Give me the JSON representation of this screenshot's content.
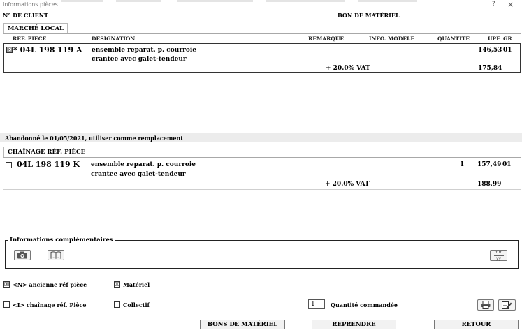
{
  "window": {
    "title": "Informations pièces",
    "help": "?",
    "close": "×"
  },
  "header": {
    "client_label": "N° DE CLIENT",
    "doc_label": "BON DE MATÉRIEL"
  },
  "tab_market": "MARCHÉ LOCAL",
  "columns": {
    "ref": "RÉF. PIÈCE",
    "designation": "DÉSIGNATION",
    "remarque": "REMARQUE",
    "info_modele": "INFO. MODÈLE",
    "quantite": "QUANTITÉ",
    "upe": "UPE",
    "gr": "GR"
  },
  "part_main": {
    "checked": "☒",
    "ref": "* 04L 198 119 A",
    "designation_1": "ensemble reparat. p. courroie",
    "designation_2": "crantee avec galet-tendeur",
    "quantity": "",
    "upe": "146,53",
    "gr": "01",
    "vat_label": "+ 20.0% VAT",
    "vat_price": "175,84"
  },
  "notice": "Abandonné le 01/05/2021, utiliser comme remplacement",
  "tab_chain": "CHAÎNAGE RÉF. PIÈCE",
  "part_replacement": {
    "ref": "04L 198 119 K",
    "designation_1": "ensemble reparat. p. courroie",
    "designation_2": "crantee avec galet-tendeur",
    "quantity": "1",
    "upe": "157,49",
    "gr": "01",
    "vat_label": "+ 20.0% VAT",
    "vat_price": "188,99"
  },
  "info_group": {
    "legend": "Informations complémentaires",
    "date_top": "mm",
    "date_bottom": "yy"
  },
  "options": {
    "old_ref_mark": "☒",
    "old_ref_label": "<N> ancienne réf pièce",
    "materiel_mark": "☒",
    "materiel_label": "Matériel",
    "chain_ref_label": "<I> chaînage réf. Pièce",
    "collectif_label": "Collectif"
  },
  "quantity": {
    "value": "1",
    "label": "Quantité commandée"
  },
  "buttons": {
    "bons": "BONS DE MATÉRIEL",
    "reprendre": "REPRENDRE",
    "retour": "RETOUR"
  },
  "icons": [
    "camera-icon",
    "book-icon",
    "calendar-icon",
    "printer-icon",
    "edit-icon"
  ]
}
